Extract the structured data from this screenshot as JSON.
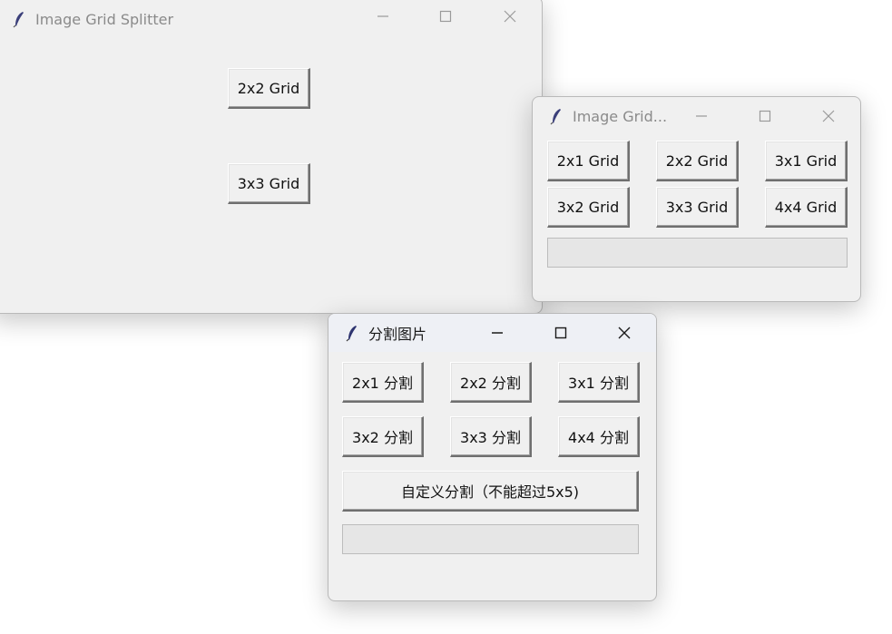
{
  "window_large": {
    "title": "Image Grid Splitter",
    "buttons": [
      "2x2 Grid",
      "3x3 Grid"
    ]
  },
  "window_small": {
    "title": "Image Grid...",
    "buttons": [
      "2x1 Grid",
      "2x2 Grid",
      "3x1 Grid",
      "3x2 Grid",
      "3x3 Grid",
      "4x4 Grid"
    ]
  },
  "window_cn": {
    "title": "分割图片",
    "buttons": [
      "2x1 分割",
      "2x2 分割",
      "3x1 分割",
      "3x2 分割",
      "3x3 分割",
      "4x4 分割"
    ],
    "custom_button": "自定义分割（不能超过5x5)"
  },
  "icons": {
    "app": "feather-icon",
    "minimize": "minimize-icon",
    "maximize": "maximize-icon",
    "close": "close-icon"
  }
}
